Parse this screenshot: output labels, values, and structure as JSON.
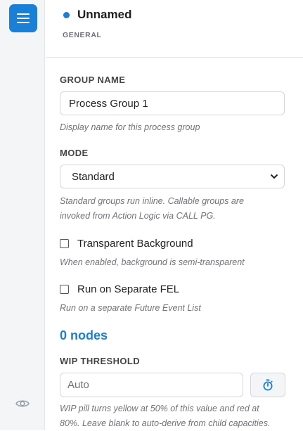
{
  "sidebar": {
    "menu_icon": "menu-icon",
    "eye_icon": "eye-icon"
  },
  "header": {
    "title": "Unnamed",
    "subtitle": "GENERAL",
    "status_color": "#1a7fd6"
  },
  "group_name": {
    "label": "GROUP NAME",
    "value": "Process Group 1",
    "help": "Display name for this process group"
  },
  "mode": {
    "label": "MODE",
    "selected": "Standard",
    "help_line1": "Standard groups run inline. Callable groups are",
    "help_line2": "invoked from Action Logic via CALL PG."
  },
  "transparent_bg": {
    "label": "Transparent Background",
    "checked": false,
    "help": "When enabled, background is semi-transparent"
  },
  "separate_fel": {
    "label": "Run on Separate FEL",
    "checked": false,
    "help": "Run on a separate Future Event List"
  },
  "node_count": "0 nodes",
  "wip": {
    "label": "WIP THRESHOLD",
    "placeholder": "Auto",
    "timer_icon": "stopwatch-icon",
    "help_line1": "WIP pill turns yellow at 50% of this value and red at",
    "help_line2": "80%. Leave blank to auto-derive from child capacities."
  },
  "colors": {
    "accent": "#1a7fd6"
  }
}
